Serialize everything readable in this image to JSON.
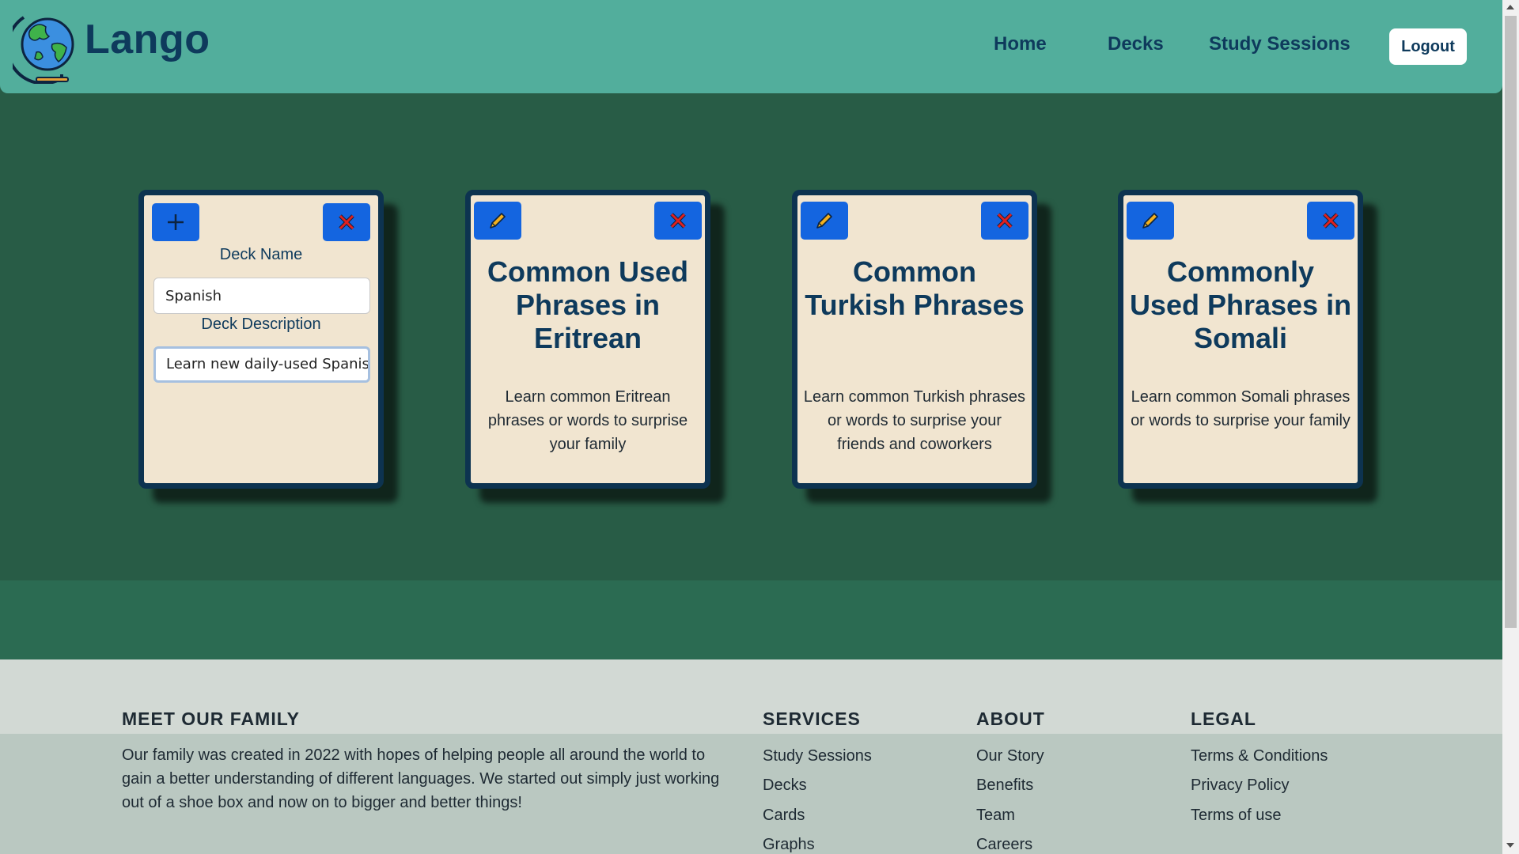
{
  "header": {
    "brand": "Lango",
    "nav": {
      "home": "Home",
      "decks": "Decks",
      "study": "Study Sessions"
    },
    "logout": "Logout"
  },
  "new_deck_form": {
    "name_label": "Deck Name",
    "name_value": "Spanish",
    "description_label": "Deck Description",
    "description_value": "Learn new daily-used Spanish"
  },
  "decks": [
    {
      "title": "Common Used Phrases in Eritrean",
      "description": "Learn common Eritrean phrases or words to surprise your family"
    },
    {
      "title": "Common Turkish Phrases",
      "description": "Learn common Turkish phrases or words to surprise your friends and coworkers"
    },
    {
      "title": "Commonly Used Phrases in Somali",
      "description": "Learn common Somali phrases or words to surprise your family"
    }
  ],
  "footer": {
    "family": {
      "heading": "MEET OUR FAMILY",
      "text": "Our family was created in 2022 with hopes of helping people all around the world to gain a better understanding of different languages. We started out simply just working out of a shoe box and now on to bigger and better things!"
    },
    "services": {
      "heading": "SERVICES",
      "links": [
        "Study Sessions",
        "Decks",
        "Cards",
        "Graphs"
      ]
    },
    "about": {
      "heading": "ABOUT",
      "links": [
        "Our Story",
        "Benefits",
        "Team",
        "Careers"
      ]
    },
    "legal": {
      "heading": "LEGAL",
      "links": [
        "Terms & Conditions",
        "Privacy Policy",
        "Terms of use"
      ]
    }
  },
  "colors": {
    "header_bg": "#52ae9c",
    "main_bg": "#285c46",
    "card_bg": "#f1e5d0",
    "card_border": "#0d3350",
    "button_blue": "#1465e0",
    "delete_x": "#e02020",
    "brand_text": "#0e3a5c",
    "footer_bg": "#d2d9d4"
  },
  "icons": {
    "logo": "globe-icon",
    "add": "plus-icon",
    "edit": "pencil-icon",
    "delete": "close-icon"
  }
}
